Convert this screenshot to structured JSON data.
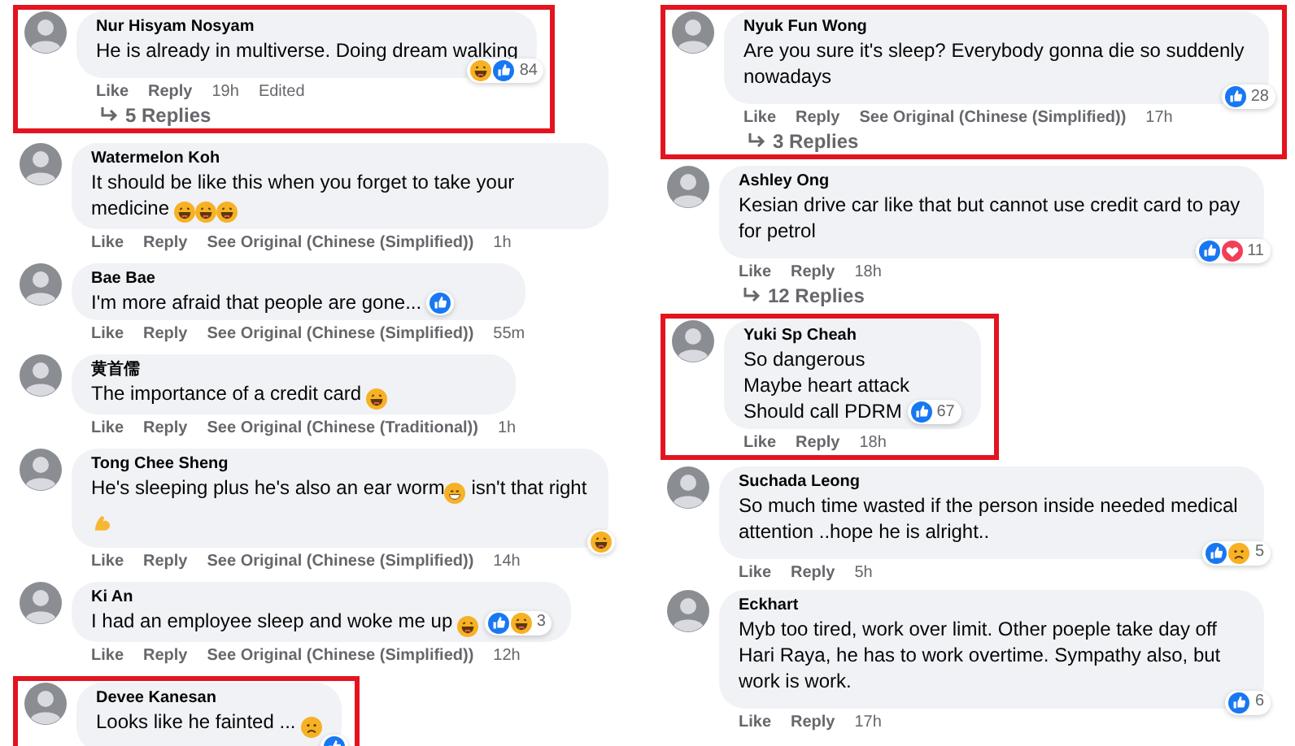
{
  "columns": [
    {
      "comments": [
        {
          "name": "Nur Hisyam Nosyam",
          "highlighted": true,
          "body": [
            {
              "kind": "text",
              "text": "He is already in multiverse. Doing dream walking"
            }
          ],
          "corner_reactions": {
            "icons": [
              {
                "kind": "haha"
              },
              {
                "kind": "like"
              }
            ],
            "count": "84"
          },
          "actions": [
            {
              "kind": "link",
              "label": "Like"
            },
            {
              "kind": "link",
              "label": "Reply"
            },
            {
              "kind": "meta",
              "label": "19h"
            },
            {
              "kind": "meta",
              "label": "Edited"
            }
          ],
          "replies": "5 Replies"
        },
        {
          "name": "Watermelon Koh",
          "highlighted": false,
          "body": [
            {
              "kind": "text",
              "text": "It should be like this when you forget to take your medicine "
            },
            {
              "kind": "laugh"
            },
            {
              "kind": "laugh"
            },
            {
              "kind": "laugh"
            }
          ],
          "actions": [
            {
              "kind": "link",
              "label": "Like"
            },
            {
              "kind": "link",
              "label": "Reply"
            },
            {
              "kind": "link",
              "label": "See Original (Chinese (Simplified))"
            },
            {
              "kind": "meta",
              "label": "1h"
            }
          ]
        },
        {
          "name": "Bae Bae",
          "highlighted": false,
          "body": [
            {
              "kind": "text",
              "text": "I'm more afraid that people are gone..."
            }
          ],
          "inline_reactions": {
            "icons": [
              {
                "kind": "like"
              }
            ]
          },
          "actions": [
            {
              "kind": "link",
              "label": "Like"
            },
            {
              "kind": "link",
              "label": "Reply"
            },
            {
              "kind": "link",
              "label": "See Original (Chinese (Simplified))"
            },
            {
              "kind": "meta",
              "label": "55m"
            }
          ]
        },
        {
          "name": "黄首儒",
          "highlighted": false,
          "body": [
            {
              "kind": "text",
              "text": "The importance of a credit card "
            },
            {
              "kind": "haha"
            }
          ],
          "actions": [
            {
              "kind": "link",
              "label": "Like"
            },
            {
              "kind": "link",
              "label": "Reply"
            },
            {
              "kind": "link",
              "label": "See Original (Chinese (Traditional))"
            },
            {
              "kind": "meta",
              "label": "1h"
            }
          ]
        },
        {
          "name": "Tong Chee Sheng",
          "highlighted": false,
          "body": [
            {
              "kind": "text",
              "text": "He's sleeping plus he's also an ear worm"
            },
            {
              "kind": "grin"
            },
            {
              "kind": "text",
              "text": " isn't that right"
            },
            {
              "kind": "muscle"
            }
          ],
          "corner_reactions": {
            "icons": [
              {
                "kind": "haha"
              }
            ]
          },
          "actions": [
            {
              "kind": "link",
              "label": "Like"
            },
            {
              "kind": "link",
              "label": "Reply"
            },
            {
              "kind": "link",
              "label": "See Original (Chinese (Simplified))"
            },
            {
              "kind": "meta",
              "label": "14h"
            }
          ]
        },
        {
          "name": "Ki An",
          "highlighted": false,
          "body": [
            {
              "kind": "text",
              "text": "I had an employee sleep and woke me up "
            },
            {
              "kind": "laugh"
            }
          ],
          "inline_reactions": {
            "icons": [
              {
                "kind": "like"
              },
              {
                "kind": "haha"
              }
            ],
            "count": "3"
          },
          "actions": [
            {
              "kind": "link",
              "label": "Like"
            },
            {
              "kind": "link",
              "label": "Reply"
            },
            {
              "kind": "link",
              "label": "See Original (Chinese (Simplified))"
            },
            {
              "kind": "meta",
              "label": "12h"
            }
          ]
        },
        {
          "name": "Devee Kanesan",
          "highlighted": true,
          "body": [
            {
              "kind": "text",
              "text": "Looks like he fainted ... "
            },
            {
              "kind": "sad"
            }
          ],
          "corner_reactions": {
            "icons": [
              {
                "kind": "like"
              }
            ]
          }
        }
      ]
    },
    {
      "comments": [
        {
          "name": "Nyuk Fun Wong",
          "highlighted": true,
          "body": [
            {
              "kind": "text",
              "text": "Are you sure it's sleep? Everybody gonna die so suddenly nowadays"
            }
          ],
          "corner_reactions": {
            "icons": [
              {
                "kind": "like"
              }
            ],
            "count": "28"
          },
          "actions": [
            {
              "kind": "link",
              "label": "Like"
            },
            {
              "kind": "link",
              "label": "Reply"
            },
            {
              "kind": "link",
              "label": "See Original (Chinese (Simplified))"
            },
            {
              "kind": "meta",
              "label": "17h"
            }
          ],
          "replies": "3 Replies"
        },
        {
          "name": "Ashley Ong",
          "highlighted": false,
          "body": [
            {
              "kind": "text",
              "text": "Kesian drive car like that but cannot use credit card to pay for petrol"
            }
          ],
          "corner_reactions": {
            "icons": [
              {
                "kind": "like"
              },
              {
                "kind": "love"
              }
            ],
            "count": "11"
          },
          "actions": [
            {
              "kind": "link",
              "label": "Like"
            },
            {
              "kind": "link",
              "label": "Reply"
            },
            {
              "kind": "meta",
              "label": "18h"
            }
          ],
          "replies": "12 Replies"
        },
        {
          "name": "Yuki Sp Cheah",
          "highlighted": true,
          "body": [
            {
              "kind": "text",
              "text": "So dangerous\nMaybe heart attack\nShould call PDRM"
            }
          ],
          "inline_reactions": {
            "icons": [
              {
                "kind": "like"
              }
            ],
            "count": "67"
          },
          "actions": [
            {
              "kind": "link",
              "label": "Like"
            },
            {
              "kind": "link",
              "label": "Reply"
            },
            {
              "kind": "meta",
              "label": "18h"
            }
          ]
        },
        {
          "name": "Suchada Leong",
          "highlighted": false,
          "body": [
            {
              "kind": "text",
              "text": "So much time wasted if the person inside needed medical attention ..hope he is alright.."
            }
          ],
          "corner_reactions": {
            "icons": [
              {
                "kind": "like"
              },
              {
                "kind": "sad"
              }
            ],
            "count": "5"
          },
          "actions": [
            {
              "kind": "link",
              "label": "Like"
            },
            {
              "kind": "link",
              "label": "Reply"
            },
            {
              "kind": "meta",
              "label": "5h"
            }
          ]
        },
        {
          "name": "Eckhart",
          "highlighted": false,
          "body": [
            {
              "kind": "text",
              "text": "Myb too tired, work over limit. Other poeple take day off Hari Raya, he has to work overtime. Sympathy also, but work is work."
            }
          ],
          "corner_reactions": {
            "icons": [
              {
                "kind": "like"
              }
            ],
            "count": "6"
          },
          "actions": [
            {
              "kind": "link",
              "label": "Like"
            },
            {
              "kind": "link",
              "label": "Reply"
            },
            {
              "kind": "meta",
              "label": "17h"
            }
          ]
        }
      ]
    }
  ]
}
